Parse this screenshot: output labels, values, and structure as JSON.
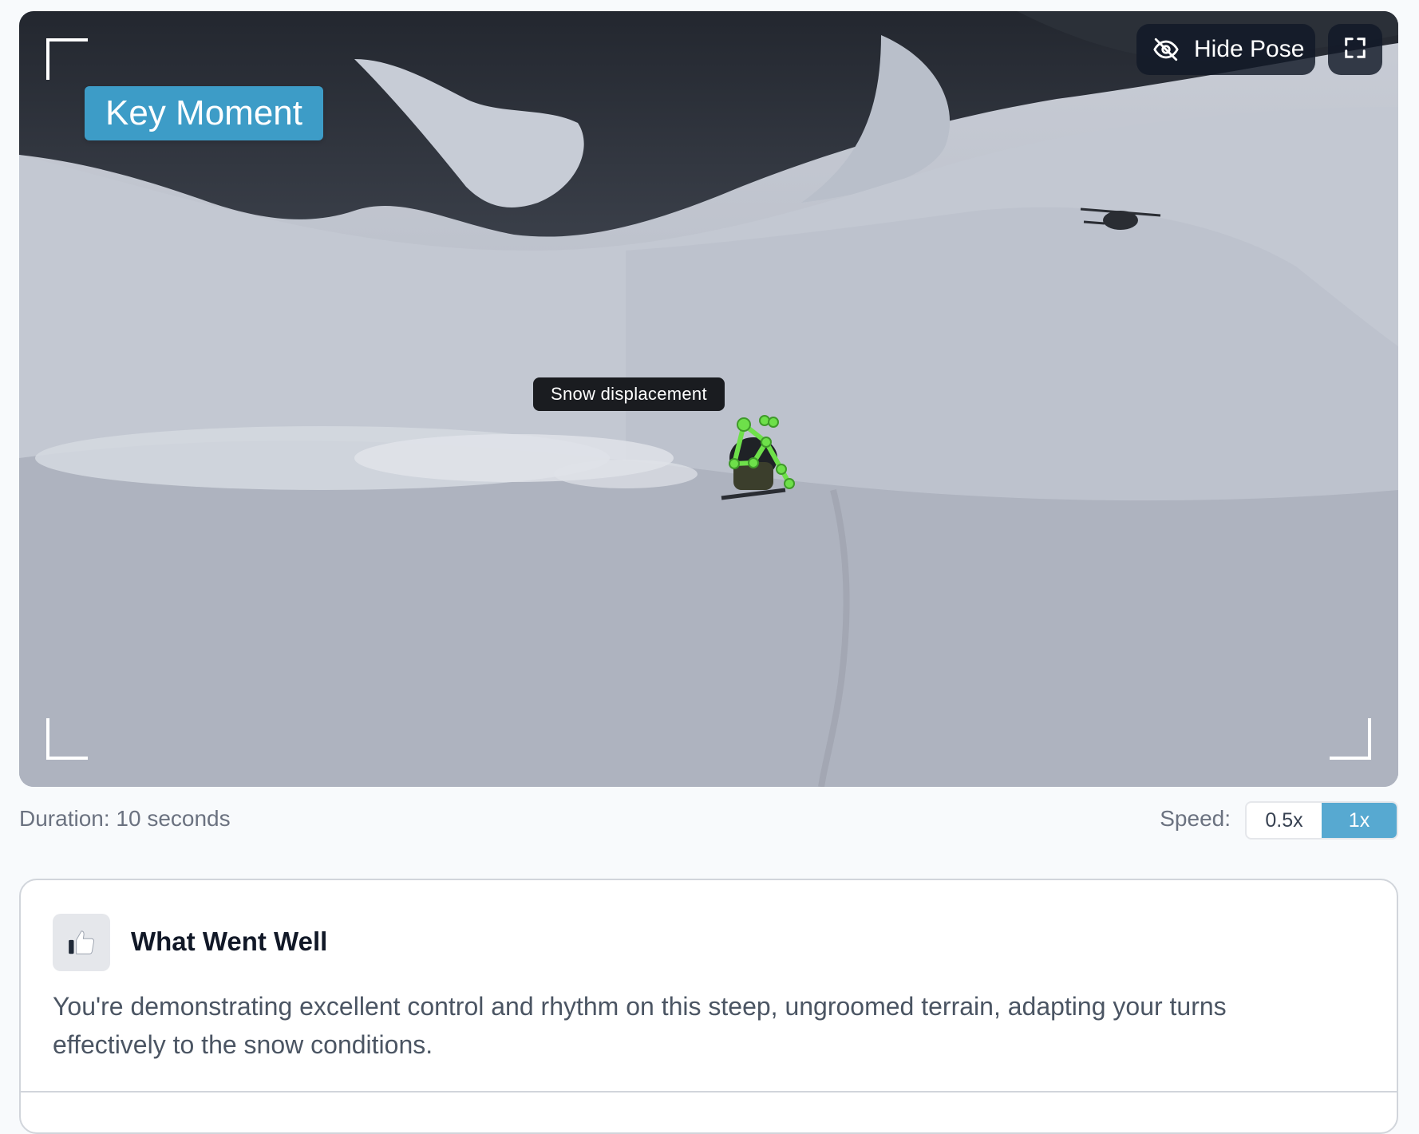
{
  "video": {
    "badge": "Key Moment",
    "tooltip": "Snow displacement",
    "pose_button_label": "Hide Pose",
    "pose_button_icon": "eye-off-icon",
    "fullscreen_icon": "fullscreen-icon",
    "pose_color": "#6ee04a",
    "badge_color": "#3d9cc7"
  },
  "controls": {
    "duration": "Duration: 10 seconds",
    "speed_label": "Speed:",
    "speed_options": [
      "0.5x",
      "1x"
    ],
    "speed_selected": "1x"
  },
  "feedback": {
    "icon": "thumbs-up-icon",
    "title": "What Went Well",
    "body": "You're demonstrating excellent control and rhythm on this steep, ungroomed terrain, adapting your turns effectively to the snow conditions."
  }
}
